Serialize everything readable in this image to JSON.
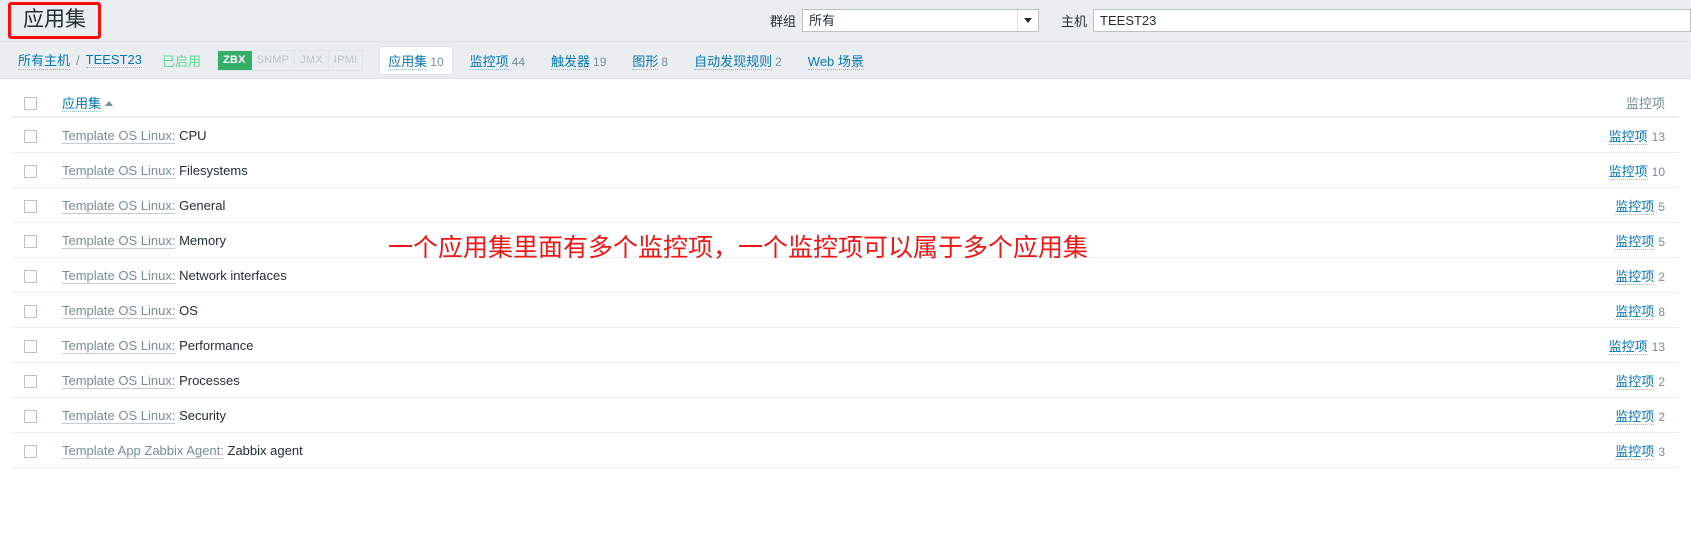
{
  "header": {
    "page_title": "应用集",
    "filter": {
      "group_label": "群组",
      "group_value": "所有",
      "group_caret_icon": "chevron-down-icon",
      "host_label": "主机",
      "host_value": "TEEST23",
      "host_placeholder": "主机"
    }
  },
  "nav": {
    "breadcrumb": {
      "all_hosts": "所有主机",
      "separator": "/",
      "host": "TEEST23"
    },
    "status": "已启用",
    "interfaces": [
      {
        "label": "ZBX",
        "active": true
      },
      {
        "label": "SNMP",
        "active": false
      },
      {
        "label": "JMX",
        "active": false
      },
      {
        "label": "IPMI",
        "active": false
      }
    ],
    "tabs": [
      {
        "label": "应用集",
        "count": "10",
        "selected": true
      },
      {
        "label": "监控项",
        "count": "44",
        "selected": false
      },
      {
        "label": "触发器",
        "count": "19",
        "selected": false
      },
      {
        "label": "图形",
        "count": "8",
        "selected": false
      },
      {
        "label": "自动发现规则",
        "count": "2",
        "selected": false
      },
      {
        "label": "Web 场景",
        "count": "",
        "selected": false
      }
    ]
  },
  "table": {
    "columns": {
      "application": "应用集",
      "sort_arrow_icon": "sort-asc-icon",
      "items": "监控项"
    },
    "rows": [
      {
        "template": "Template OS Linux:",
        "name": "CPU",
        "items_label": "监控项",
        "items_count": "13"
      },
      {
        "template": "Template OS Linux:",
        "name": "Filesystems",
        "items_label": "监控项",
        "items_count": "10"
      },
      {
        "template": "Template OS Linux:",
        "name": "General",
        "items_label": "监控项",
        "items_count": "5"
      },
      {
        "template": "Template OS Linux:",
        "name": "Memory",
        "items_label": "监控项",
        "items_count": "5"
      },
      {
        "template": "Template OS Linux:",
        "name": "Network interfaces",
        "items_label": "监控项",
        "items_count": "2"
      },
      {
        "template": "Template OS Linux:",
        "name": "OS",
        "items_label": "监控项",
        "items_count": "8"
      },
      {
        "template": "Template OS Linux:",
        "name": "Performance",
        "items_label": "监控项",
        "items_count": "13"
      },
      {
        "template": "Template OS Linux:",
        "name": "Processes",
        "items_label": "监控项",
        "items_count": "2"
      },
      {
        "template": "Template OS Linux:",
        "name": "Security",
        "items_label": "监控项",
        "items_count": "2"
      },
      {
        "template": "Template App Zabbix Agent:",
        "name": "Zabbix agent",
        "items_label": "监控项",
        "items_count": "3"
      }
    ]
  },
  "annotation": {
    "text": "一个应用集里面有多个监控项，一个监控项可以属于多个应用集",
    "color": "#f01616"
  },
  "colors": {
    "accent_link": "#0275b8",
    "muted": "#768d99",
    "chrome_bg": "#ebeef0",
    "enabled_green": "#59db8f",
    "zbx_green": "#34af67",
    "annotation_red": "#f01616",
    "title_box_red": "#fb0d0d"
  }
}
